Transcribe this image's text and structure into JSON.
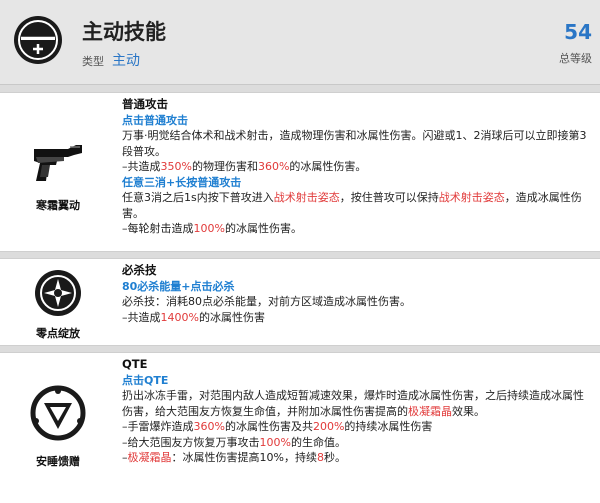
{
  "header": {
    "title": "主动技能",
    "type_label": "类型",
    "type_value": "主动",
    "level_value": "54",
    "level_label": "总等级"
  },
  "sections": [
    {
      "name": "寒霜翼动",
      "icon": "gun-icon",
      "title": "普通攻击",
      "sub1": "点击普通攻击",
      "l1": "万事·明觉结合体术和战术射击，造成物理伤害和冰属性伤害。闪避或1、2消球后可以立即接第3段普攻。",
      "l2_a": "–共造成",
      "l2_b": "350%",
      "l2_c": "的物理伤害和",
      "l2_d": "360%",
      "l2_e": "的冰属性伤害。",
      "sub2": "任意三消+长按普通攻击",
      "l3_a": "任意3消之后1s内按下普攻进入",
      "l3_b": "战术射击姿态",
      "l3_c": "，按住普攻可以保持",
      "l3_d": "战术射击姿态",
      "l3_e": "，造成冰属性伤害。",
      "l4_a": "–每轮射击造成",
      "l4_b": "100%",
      "l4_c": "的冰属性伤害。"
    },
    {
      "name": "零点绽放",
      "icon": "burst-icon",
      "title": "必杀技",
      "sub1": "80必杀能量+点击必杀",
      "l1": "必杀技：消耗80点必杀能量，对前方区域造成冰属性伤害。",
      "l2_a": "–共造成",
      "l2_b": "1400%",
      "l2_c": "的冰属性伤害"
    },
    {
      "name": "安睡馈赠",
      "icon": "shield-icon",
      "title": "QTE",
      "sub1": "点击QTE",
      "l1_a": "扔出冰冻手雷，对范围内敌人造成短暂减速效果，爆炸时造成冰属性伤害，之后持续造成冰属性伤害，给大范围友方恢复生命值，并附加冰属性伤害提高的",
      "l1_b": "极凝霜晶",
      "l1_c": "效果。",
      "l2_a": "–手雷爆炸造成",
      "l2_b": "360%",
      "l2_c": "的冰属性伤害及共",
      "l2_d": "200%",
      "l2_e": "的持续冰属性伤害",
      "l3_a": "–给大范围友方恢复万事攻击",
      "l3_b": "100%",
      "l3_c": "的生命值。",
      "l4_a": "–",
      "l4_b": "极凝霜晶",
      "l4_c": "：冰属性伤害提高10%，持续",
      "l4_d": "8",
      "l4_e": "秒。"
    }
  ]
}
